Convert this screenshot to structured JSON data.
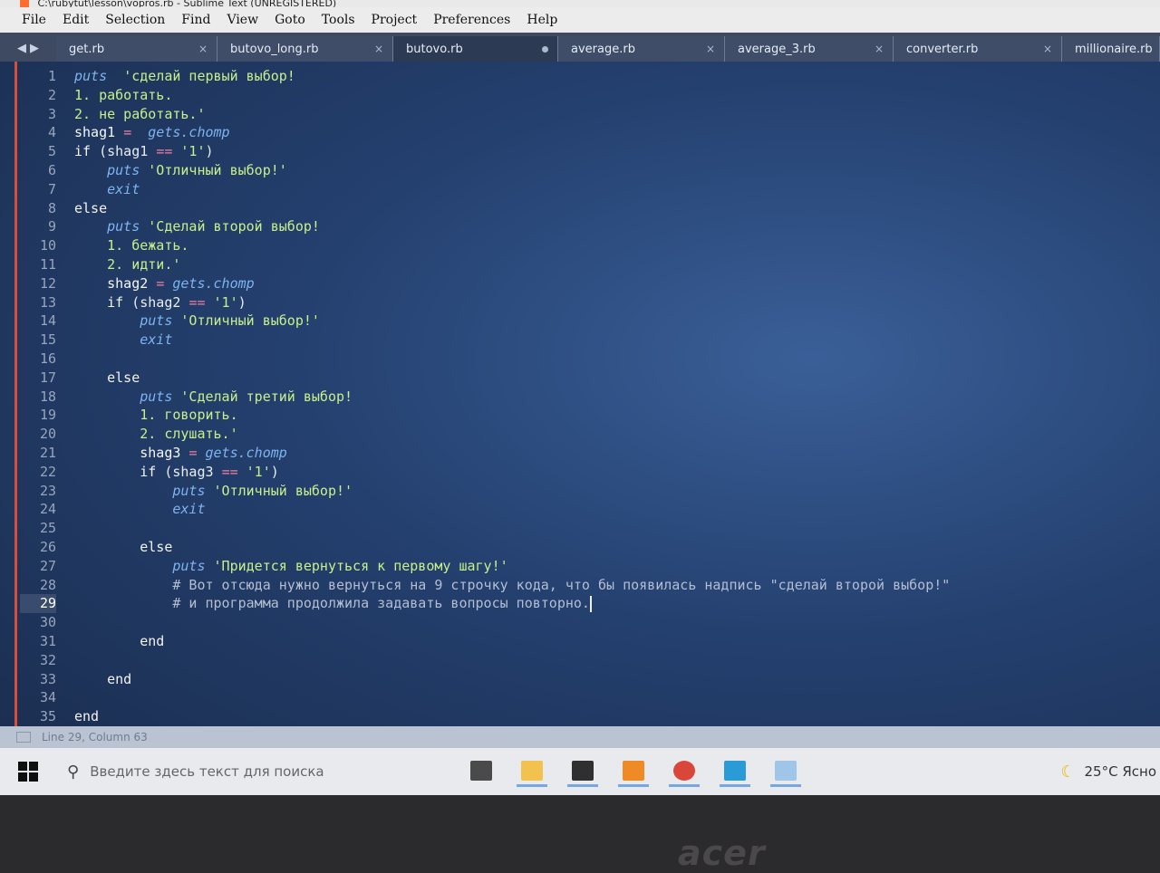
{
  "window": {
    "title": "C:\\rubytut\\lesson\\vopros.rb - Sublime Text (UNREGISTERED)"
  },
  "menu": [
    "File",
    "Edit",
    "Selection",
    "Find",
    "View",
    "Goto",
    "Tools",
    "Project",
    "Preferences",
    "Help"
  ],
  "tabs": [
    {
      "label": "get.rb",
      "width": 178,
      "state": "close"
    },
    {
      "label": "butovo_long.rb",
      "width": 194,
      "state": "close"
    },
    {
      "label": "butovo.rb",
      "width": 182,
      "state": "dirty",
      "active": true
    },
    {
      "label": "average.rb",
      "width": 184,
      "state": "close"
    },
    {
      "label": "average_3.rb",
      "width": 186,
      "state": "close"
    },
    {
      "label": "converter.rb",
      "width": 186,
      "state": "close"
    },
    {
      "label": "millionaire.rb",
      "width": 108,
      "state": "none"
    }
  ],
  "editor": {
    "current_line": 29,
    "lines": [
      [
        [
          "k-puts",
          "puts"
        ],
        [
          "",
          "  "
        ],
        [
          "k-str",
          "'сделай первый выбор!"
        ]
      ],
      [
        [
          "k-str",
          "1. работать."
        ]
      ],
      [
        [
          "k-str",
          "2. не работать.'"
        ]
      ],
      [
        [
          "k-var",
          "shag1 "
        ],
        [
          "k-op",
          "="
        ],
        [
          "",
          "  "
        ],
        [
          "k-gets",
          "gets"
        ],
        [
          "",
          ""
        ],
        [
          "k-chomp",
          ".chomp"
        ]
      ],
      [
        [
          "k-kw",
          "if "
        ],
        [
          "",
          "(shag1 "
        ],
        [
          "k-op",
          "=="
        ],
        [
          "",
          ""
        ],
        [
          "k-str",
          " '1'"
        ],
        [
          "",
          ")"
        ]
      ],
      [
        [
          "",
          "    "
        ],
        [
          "k-puts",
          "puts"
        ],
        [
          "",
          ""
        ],
        [
          "k-str",
          " 'Отличный выбор!'"
        ]
      ],
      [
        [
          "",
          "    "
        ],
        [
          "k-exit",
          "exit"
        ]
      ],
      [
        [
          "k-kw",
          "else"
        ]
      ],
      [
        [
          "",
          "    "
        ],
        [
          "k-puts",
          "puts"
        ],
        [
          "",
          ""
        ],
        [
          "k-str",
          " 'Сделай второй выбор!"
        ]
      ],
      [
        [
          "",
          "    "
        ],
        [
          "k-str",
          "1. бежать."
        ]
      ],
      [
        [
          "",
          "    "
        ],
        [
          "k-str",
          "2. идти.'"
        ]
      ],
      [
        [
          "",
          "    "
        ],
        [
          "k-var",
          "shag2 "
        ],
        [
          "k-op",
          "="
        ],
        [
          "",
          ""
        ],
        [
          "k-gets",
          " gets"
        ],
        [
          "k-chomp",
          ".chomp"
        ]
      ],
      [
        [
          "",
          "    "
        ],
        [
          "k-kw",
          "if "
        ],
        [
          "",
          "(shag2 "
        ],
        [
          "k-op",
          "=="
        ],
        [
          "k-str",
          " '1'"
        ],
        [
          "",
          ")"
        ]
      ],
      [
        [
          "",
          "        "
        ],
        [
          "k-puts",
          "puts"
        ],
        [
          "k-str",
          " 'Отличный выбор!'"
        ]
      ],
      [
        [
          "",
          "        "
        ],
        [
          "k-exit",
          "exit"
        ]
      ],
      [
        [
          "",
          ""
        ]
      ],
      [
        [
          "",
          "    "
        ],
        [
          "k-kw",
          "else"
        ]
      ],
      [
        [
          "",
          "        "
        ],
        [
          "k-puts",
          "puts"
        ],
        [
          "k-str",
          " 'Сделай третий выбор!"
        ]
      ],
      [
        [
          "",
          "        "
        ],
        [
          "k-str",
          "1. говорить."
        ]
      ],
      [
        [
          "",
          "        "
        ],
        [
          "k-str",
          "2. слушать.'"
        ]
      ],
      [
        [
          "",
          "        "
        ],
        [
          "k-var",
          "shag3 "
        ],
        [
          "k-op",
          "="
        ],
        [
          "k-gets",
          " gets"
        ],
        [
          "k-chomp",
          ".chomp"
        ]
      ],
      [
        [
          "",
          "        "
        ],
        [
          "k-kw",
          "if "
        ],
        [
          "",
          "(shag3 "
        ],
        [
          "k-op",
          "=="
        ],
        [
          "k-str",
          " '1'"
        ],
        [
          "",
          ")"
        ]
      ],
      [
        [
          "",
          "            "
        ],
        [
          "k-puts",
          "puts"
        ],
        [
          "k-str",
          " 'Отличный выбор!'"
        ]
      ],
      [
        [
          "",
          "            "
        ],
        [
          "k-exit",
          "exit"
        ]
      ],
      [
        [
          "",
          ""
        ]
      ],
      [
        [
          "",
          "        "
        ],
        [
          "k-kw",
          "else"
        ]
      ],
      [
        [
          "",
          "            "
        ],
        [
          "k-puts",
          "puts"
        ],
        [
          "k-str",
          " 'Придется вернуться к первому шагу!'"
        ]
      ],
      [
        [
          "",
          "            "
        ],
        [
          "k-cmt",
          "# Вот отсюда нужно вернуться на 9 строчку кода, что бы появилась надпись \"сделай второй выбор!\""
        ]
      ],
      [
        [
          "",
          "            "
        ],
        [
          "k-cmt",
          "# и программа продолжила задавать вопросы повторно."
        ]
      ],
      [
        [
          "",
          ""
        ]
      ],
      [
        [
          "",
          "        "
        ],
        [
          "k-kw",
          "end"
        ]
      ],
      [
        [
          "",
          ""
        ]
      ],
      [
        [
          "",
          "    "
        ],
        [
          "k-kw",
          "end"
        ]
      ],
      [
        [
          "",
          ""
        ]
      ],
      [
        [
          "k-kw",
          "end"
        ]
      ]
    ]
  },
  "status": {
    "position": "Line 29, Column 63"
  },
  "taskbar": {
    "search_placeholder": "Введите здесь текст для поиска",
    "apps": [
      {
        "name": "task-view",
        "color": "#4a4a4a",
        "running": false
      },
      {
        "name": "file-explorer",
        "color": "#f2c14e",
        "running": true
      },
      {
        "name": "terminal",
        "color": "#2f2f2f",
        "running": true
      },
      {
        "name": "sublime-text",
        "color": "#f08a24",
        "running": true
      },
      {
        "name": "chrome",
        "color": "#d9473b",
        "running": true
      },
      {
        "name": "photos",
        "color": "#2b9bd8",
        "running": true
      },
      {
        "name": "paint",
        "color": "#9fc6e8",
        "running": true
      }
    ],
    "weather": "25°C  Ясно"
  },
  "bezel": {
    "brand": "acer"
  }
}
